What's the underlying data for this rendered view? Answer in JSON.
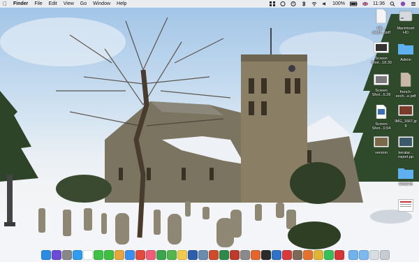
{
  "menubar": {
    "apple": "",
    "app_name": "Finder",
    "menus": [
      "File",
      "Edit",
      "View",
      "Go",
      "Window",
      "Help"
    ],
    "battery": "100%",
    "time": "11:36"
  },
  "desktop_icons": [
    {
      "label": "HC...\ndepth...pdf",
      "kind": "doc"
    },
    {
      "label": "Macintosh\nHD",
      "kind": "drive"
    },
    {
      "label": "Screen\nShot...18.30",
      "kind": "shot"
    },
    {
      "label": "Admin",
      "kind": "folder"
    },
    {
      "label": "Screen\nShot...6.28",
      "kind": "shot"
    },
    {
      "label": "french-\nexch...e.pdf",
      "kind": "doc"
    },
    {
      "label": "Screen\nShot...0.54",
      "kind": "doc"
    },
    {
      "label": "IMG_1667.jp\ng",
      "kind": "photo"
    },
    {
      "label": "version",
      "kind": "photo"
    },
    {
      "label": "keralar...\nreport.pp",
      "kind": "photo"
    },
    {
      "label": "",
      "kind": "folder"
    },
    {
      "label": "GM&HB",
      "kind": "folder"
    },
    {
      "label": "",
      "kind": "doc"
    }
  ],
  "dock": {
    "apps": [
      {
        "name": "finder-icon",
        "color": "#2a8de3"
      },
      {
        "name": "siri-icon",
        "color": "#6b4bd8"
      },
      {
        "name": "launchpad-icon",
        "color": "#888888"
      },
      {
        "name": "safari-icon",
        "color": "#2e9cf0"
      },
      {
        "name": "calendar-icon",
        "color": "#ffffff"
      },
      {
        "name": "messages-icon",
        "color": "#41c148"
      },
      {
        "name": "facetime-icon",
        "color": "#3fbf3f"
      },
      {
        "name": "photos-icon",
        "color": "#e9a63c"
      },
      {
        "name": "app-store-icon",
        "color": "#3a8ff0"
      },
      {
        "name": "chrome-icon",
        "color": "#e24b3b"
      },
      {
        "name": "music-icon",
        "color": "#f45b78"
      },
      {
        "name": "green-app-icon",
        "color": "#3aa54a"
      },
      {
        "name": "evernote-icon",
        "color": "#53b54a"
      },
      {
        "name": "notes-icon",
        "color": "#f2c94c"
      },
      {
        "name": "word-icon",
        "color": "#2b5fae"
      },
      {
        "name": "preview-icon",
        "color": "#6a8caf"
      },
      {
        "name": "powerpoint-icon",
        "color": "#d04b2a"
      },
      {
        "name": "excel-icon",
        "color": "#2c8a4b"
      },
      {
        "name": "pdf-app-icon",
        "color": "#c03a2b"
      },
      {
        "name": "gear-icon",
        "color": "#8a8a8a"
      },
      {
        "name": "firefox-icon",
        "color": "#e5662d"
      },
      {
        "name": "quicktime-icon",
        "color": "#2b2b2b"
      },
      {
        "name": "blue-app-icon",
        "color": "#2e72c9"
      },
      {
        "name": "red-app-icon",
        "color": "#d83a3a"
      },
      {
        "name": "photo-app-icon",
        "color": "#7c6a56"
      },
      {
        "name": "game-icon",
        "color": "#e3722f"
      },
      {
        "name": "butterfly-icon",
        "color": "#e1b431"
      },
      {
        "name": "whatsapp-icon",
        "color": "#35c15a"
      },
      {
        "name": "red-circle-app-icon",
        "color": "#d73535"
      },
      {
        "name": "folder-icon",
        "color": "#6fb2ee"
      },
      {
        "name": "downloads-icon",
        "color": "#7cb9ef"
      },
      {
        "name": "document-stack-icon",
        "color": "#d8dde4"
      },
      {
        "name": "trash-icon",
        "color": "#c7ccd3"
      }
    ]
  }
}
